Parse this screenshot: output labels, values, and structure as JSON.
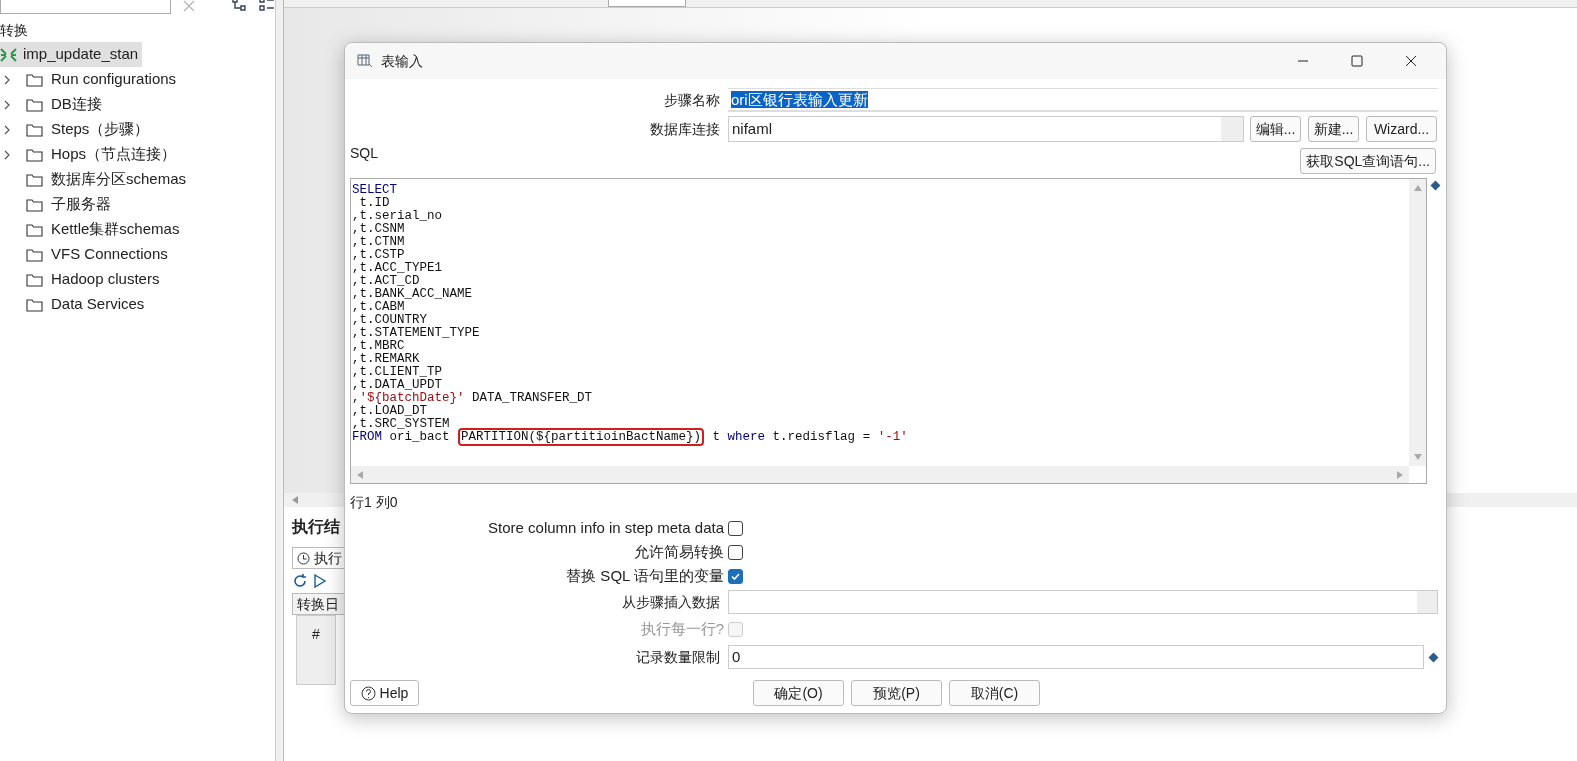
{
  "sidebar": {
    "section_title": "转换",
    "root": {
      "label": "imp_update_stan",
      "selected": true,
      "children": [
        {
          "label": "Run configurations",
          "kind": "expandable"
        },
        {
          "label": "DB连接",
          "kind": "expandable"
        },
        {
          "label": "Steps（步骤）",
          "kind": "expandable"
        },
        {
          "label": "Hops（节点连接）",
          "kind": "expandable"
        },
        {
          "label": "数据库分区schemas",
          "kind": "leaf"
        },
        {
          "label": "子服务器",
          "kind": "leaf"
        },
        {
          "label": "Kettle集群schemas",
          "kind": "leaf"
        },
        {
          "label": "VFS Connections",
          "kind": "leaf"
        },
        {
          "label": "Hadoop clusters",
          "kind": "leaf"
        },
        {
          "label": "Data Services",
          "kind": "leaf"
        }
      ]
    }
  },
  "results_panel": {
    "title": "执行结",
    "tab": "执行",
    "log_tab": "转换日",
    "column_1": "#"
  },
  "dialog": {
    "title": "表输入",
    "step_name": {
      "label": "步骤名称",
      "value": "ori区银行表输入更新",
      "selected": true
    },
    "connection": {
      "label": "数据库连接",
      "value": "nifaml",
      "buttons": [
        "编辑...",
        "新建...",
        "Wizard..."
      ]
    },
    "sql_label": "SQL",
    "get_sql_button": "获取SQL查询语句...",
    "sql_lines": [
      [
        {
          "text": "SELECT",
          "kind": "keyword"
        }
      ],
      [
        {
          "text": " t.ID",
          "kind": "plain"
        }
      ],
      [
        {
          "text": ",t.serial_no",
          "kind": "plain"
        }
      ],
      [
        {
          "text": ",t.CSNM",
          "kind": "plain"
        }
      ],
      [
        {
          "text": ",t.CTNM",
          "kind": "plain"
        }
      ],
      [
        {
          "text": ",t.CSTP",
          "kind": "plain"
        }
      ],
      [
        {
          "text": ",t.ACC_TYPE1",
          "kind": "plain"
        }
      ],
      [
        {
          "text": ",t.ACT_CD",
          "kind": "plain"
        }
      ],
      [
        {
          "text": ",t.BANK_ACC_NAME",
          "kind": "plain"
        }
      ],
      [
        {
          "text": ",t.CABM",
          "kind": "plain"
        }
      ],
      [
        {
          "text": ",t.COUNTRY",
          "kind": "plain"
        }
      ],
      [
        {
          "text": ",t.STATEMENT_TYPE",
          "kind": "plain"
        }
      ],
      [
        {
          "text": ",t.MBRC",
          "kind": "plain"
        }
      ],
      [
        {
          "text": ",t.REMARK",
          "kind": "plain"
        }
      ],
      [
        {
          "text": ",t.CLIENT_TP",
          "kind": "plain"
        }
      ],
      [
        {
          "text": ",t.DATA_UPDT",
          "kind": "plain"
        }
      ],
      [
        {
          "text": ",",
          "kind": "plain"
        },
        {
          "text": "'${batchDate}'",
          "kind": "string"
        },
        {
          "text": " DATA_TRANSFER_DT",
          "kind": "plain"
        }
      ],
      [
        {
          "text": ",t.LOAD_DT",
          "kind": "plain"
        }
      ],
      [
        {
          "text": ",t.SRC_SYSTEM",
          "kind": "plain"
        }
      ],
      [
        {
          "text": "FROM",
          "kind": "keyword"
        },
        {
          "text": " ori_bact ",
          "kind": "plain"
        },
        {
          "text": "PARTITION(${partitioinBactName})",
          "kind": "highlight"
        },
        {
          "text": " t ",
          "kind": "plain"
        },
        {
          "text": "where",
          "kind": "keyword"
        },
        {
          "text": " t.redisflag = ",
          "kind": "plain"
        },
        {
          "text": "'-1'",
          "kind": "string"
        }
      ]
    ],
    "cursor_position": "行1 列0",
    "options": [
      {
        "label": "Store column info in step meta data",
        "checked": false
      },
      {
        "label": "允许简易转换",
        "checked": false
      },
      {
        "label": "替换 SQL 语句里的变量",
        "checked": true
      }
    ],
    "insert_from_step": {
      "label": "从步骤插入数据"
    },
    "execute_each_row": {
      "label": "执行每一行?",
      "checked": false,
      "disabled": true
    },
    "limit": {
      "label": "记录数量限制",
      "value": "0"
    },
    "help_button": "Help",
    "buttons": [
      "确定(O)",
      "预览(P)",
      "取消(C)"
    ]
  }
}
